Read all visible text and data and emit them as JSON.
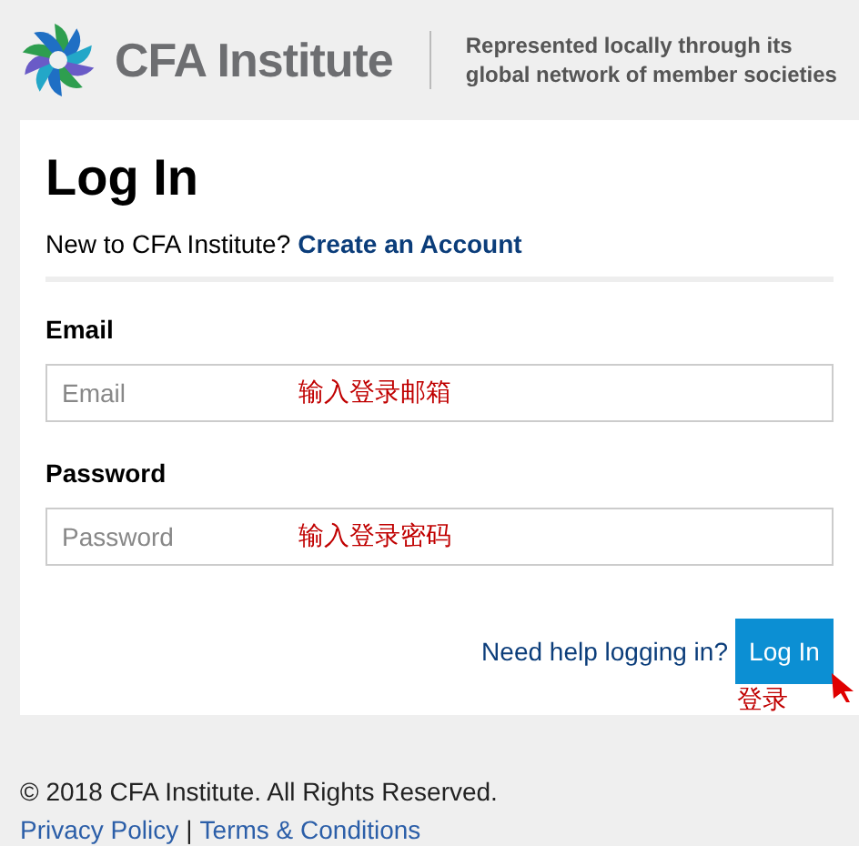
{
  "header": {
    "brand": "CFA Institute",
    "tagline": [
      "Represented locally through its",
      "global network of member societies"
    ]
  },
  "login": {
    "title": "Log In",
    "prompt": "New to CFA Institute?",
    "create_link": "Create an Account",
    "fields": [
      {
        "label": "Email",
        "placeholder": "Email",
        "annotation": "输入登录邮箱"
      },
      {
        "label": "Password",
        "placeholder": "Password",
        "annotation": "输入登录密码"
      }
    ],
    "help_link": "Need help logging in?",
    "submit": "Log In",
    "submit_annotation": "登录"
  },
  "footer": {
    "copyright": "© 2018 CFA Institute. All Rights Reserved.",
    "links": [
      "Privacy Policy",
      "Terms & Conditions"
    ],
    "separator": "|"
  }
}
